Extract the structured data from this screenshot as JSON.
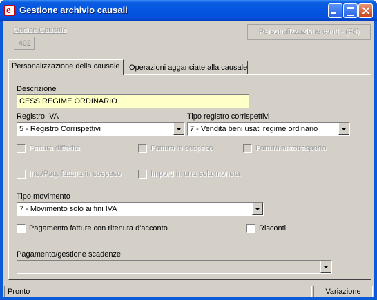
{
  "window": {
    "title": "Gestione archivio causali",
    "app_icon_letter": "e",
    "controls": [
      "minimize-icon",
      "maximize-icon",
      "close-icon"
    ]
  },
  "header": {
    "codice_label": "Codice Causale",
    "codice_value": "402",
    "pers_conti_label": "Personalizzazione conti - (F8)"
  },
  "tabs": [
    {
      "label": "Personalizzazione della causale",
      "active": true
    },
    {
      "label": "Operazioni agganciate alla causale",
      "active": false
    }
  ],
  "form": {
    "descrizione_label": "Descrizione",
    "descrizione_value": "CESS.REGIME ORDINARIO",
    "registro_iva_label": "Registro IVA",
    "registro_iva_value": "5 - Registro Corrispettivi",
    "tipo_registro_label": "Tipo registro corrispettivi",
    "tipo_registro_value": "7 - Vendita beni usati regime ordinario",
    "checkboxes_row1": [
      {
        "label": "Fattura differita",
        "checked": false,
        "enabled": false
      },
      {
        "label": "Fattura in sospeso",
        "checked": false,
        "enabled": false
      },
      {
        "label": "Fattura autotrasporto",
        "checked": false,
        "enabled": false
      }
    ],
    "checkboxes_row2": [
      {
        "label": "Inc./Pag. fattura in sospeso",
        "checked": false,
        "enabled": false
      },
      {
        "label": "Importi in una sola moneta",
        "checked": false,
        "enabled": false
      }
    ],
    "tipo_movimento_label": "Tipo movimento",
    "tipo_movimento_value": "7 - Movimento solo ai fini IVA",
    "pagamento_ritenuta_label": "Pagamento fatture con ritenuta d'acconto",
    "risconti_label": "Risconti",
    "pagamento_gestione_label": "Pagamento/gestione scadenze",
    "pagamento_gestione_value": ""
  },
  "status": {
    "left": "Pronto",
    "right": "Variazione"
  },
  "colors": {
    "titlebar": "#0554e3",
    "client_bg": "#d4d0c8",
    "highlight_field": "#ffffc8"
  }
}
